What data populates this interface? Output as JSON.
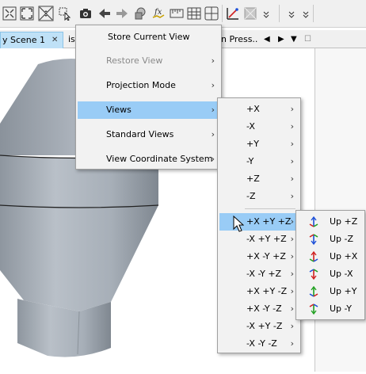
{
  "tabs": [
    {
      "label": "y Scene 1",
      "active": true,
      "close": "✕"
    },
    {
      "label": "is",
      "active": false
    },
    {
      "label": "n Press...",
      "active": false
    }
  ],
  "tab_controls": [
    "◀",
    "▶",
    "▼",
    "☐"
  ],
  "menu1": {
    "items": [
      {
        "label": "Store Current View",
        "submenu": false,
        "disabled": false,
        "selected": false
      },
      {
        "label": "Restore View",
        "submenu": true,
        "disabled": true,
        "selected": false
      },
      {
        "label": "Projection Mode",
        "submenu": true,
        "disabled": false,
        "selected": false
      },
      {
        "label": "Views",
        "submenu": true,
        "disabled": false,
        "selected": true
      },
      {
        "label": "Standard Views",
        "submenu": true,
        "disabled": false,
        "selected": false
      },
      {
        "label": "View Coordinate System",
        "submenu": true,
        "disabled": false,
        "selected": false
      }
    ]
  },
  "menu2": {
    "items": [
      {
        "label": "+X"
      },
      {
        "label": "-X"
      },
      {
        "label": "+Y"
      },
      {
        "label": "-Y"
      },
      {
        "label": "+Z"
      },
      {
        "label": "-Z"
      },
      {
        "label": "+X +Y +Z",
        "selected": true
      },
      {
        "label": "-X +Y +Z"
      },
      {
        "label": "+X -Y +Z"
      },
      {
        "label": "-X -Y +Z"
      },
      {
        "label": "+X +Y -Z"
      },
      {
        "label": "+X -Y -Z"
      },
      {
        "label": "-X +Y -Z"
      },
      {
        "label": "-X -Y -Z"
      }
    ],
    "arrow": "›"
  },
  "menu3": {
    "items": [
      {
        "label": "Up +Z"
      },
      {
        "label": "Up -Z"
      },
      {
        "label": "Up +X"
      },
      {
        "label": "Up -X"
      },
      {
        "label": "Up +Y"
      },
      {
        "label": "Up -Y"
      }
    ]
  },
  "submenu_arrow": "›",
  "colors": {
    "selection": "#99ccf6",
    "tab_active": "#bfe1f7",
    "model_gray": "#a3abb4"
  }
}
